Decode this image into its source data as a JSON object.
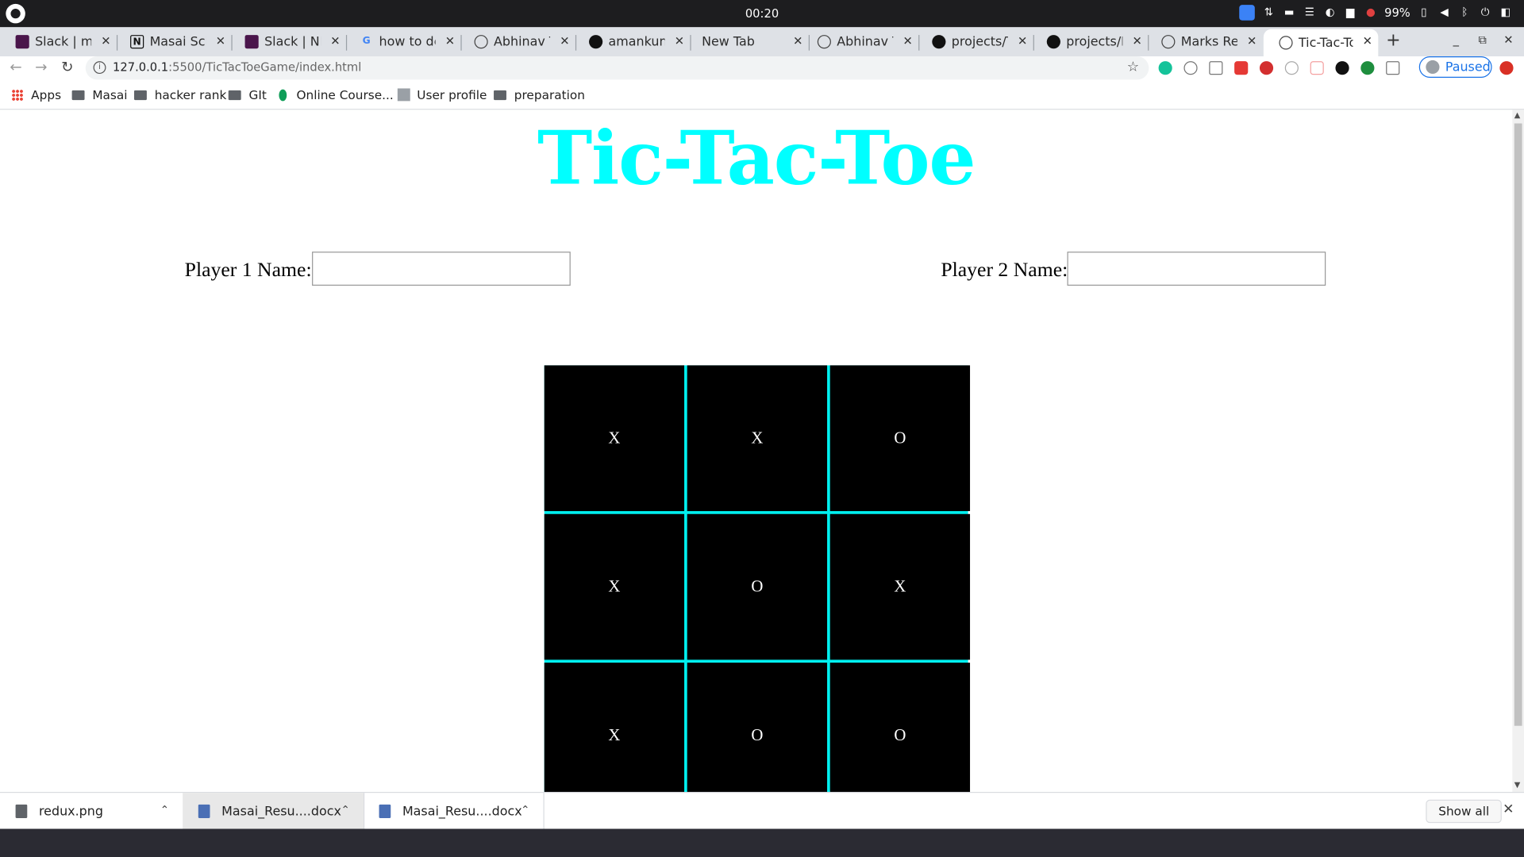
{
  "os": {
    "clock": "00:20",
    "battery": "99%"
  },
  "tabs": [
    {
      "label": "Slack | ment",
      "icon": "slack-icon"
    },
    {
      "label": "Masai Scho",
      "icon": "notion-icon"
    },
    {
      "label": "Slack | NM",
      "icon": "slack-icon"
    },
    {
      "label": "how to dep",
      "icon": "google-icon"
    },
    {
      "label": "Abhinav Th",
      "icon": "globe-icon"
    },
    {
      "label": "amankuma",
      "icon": "github-icon"
    },
    {
      "label": "New Tab",
      "icon": ""
    },
    {
      "label": "Abhinav Th",
      "icon": "globe-icon"
    },
    {
      "label": "projects/Tic",
      "icon": "github-icon"
    },
    {
      "label": "projects/M",
      "icon": "github-icon"
    },
    {
      "label": "Marks Reco",
      "icon": "globe-icon"
    },
    {
      "label": "Tic-Tac-Toe",
      "icon": "globe-icon",
      "active": true
    }
  ],
  "address": {
    "host": "127.0.0.1",
    "rest": ":5500/TicTacToeGame/index.html"
  },
  "profile": {
    "status": "Paused"
  },
  "bookmarks": [
    {
      "label": "Apps",
      "icon": "apps-grid-icon"
    },
    {
      "label": "Masai",
      "icon": "folder-icon"
    },
    {
      "label": "hacker rank",
      "icon": "folder-icon"
    },
    {
      "label": "GIt",
      "icon": "folder-icon"
    },
    {
      "label": "Online Course...",
      "icon": "leaf-icon"
    },
    {
      "label": "User profile",
      "icon": "profile-icon"
    },
    {
      "label": "preparation",
      "icon": "folder-icon"
    }
  ],
  "page": {
    "title": "Tic-Tac-Toe",
    "player1_label": "Player 1 Name:",
    "player1_value": "",
    "player2_label": "Player 2 Name:",
    "player2_value": "",
    "board": [
      "X",
      "X",
      "O",
      "X",
      "O",
      "X",
      "X",
      "O",
      "O"
    ],
    "accent_color": "#00ffff"
  },
  "downloads": [
    {
      "name": "redux.png",
      "icon": "image-file-icon"
    },
    {
      "name": "Masai_Resu....docx",
      "icon": "word-file-icon"
    },
    {
      "name": "Masai_Resu....docx",
      "icon": "word-file-icon"
    }
  ],
  "shelf": {
    "show_all": "Show all"
  }
}
